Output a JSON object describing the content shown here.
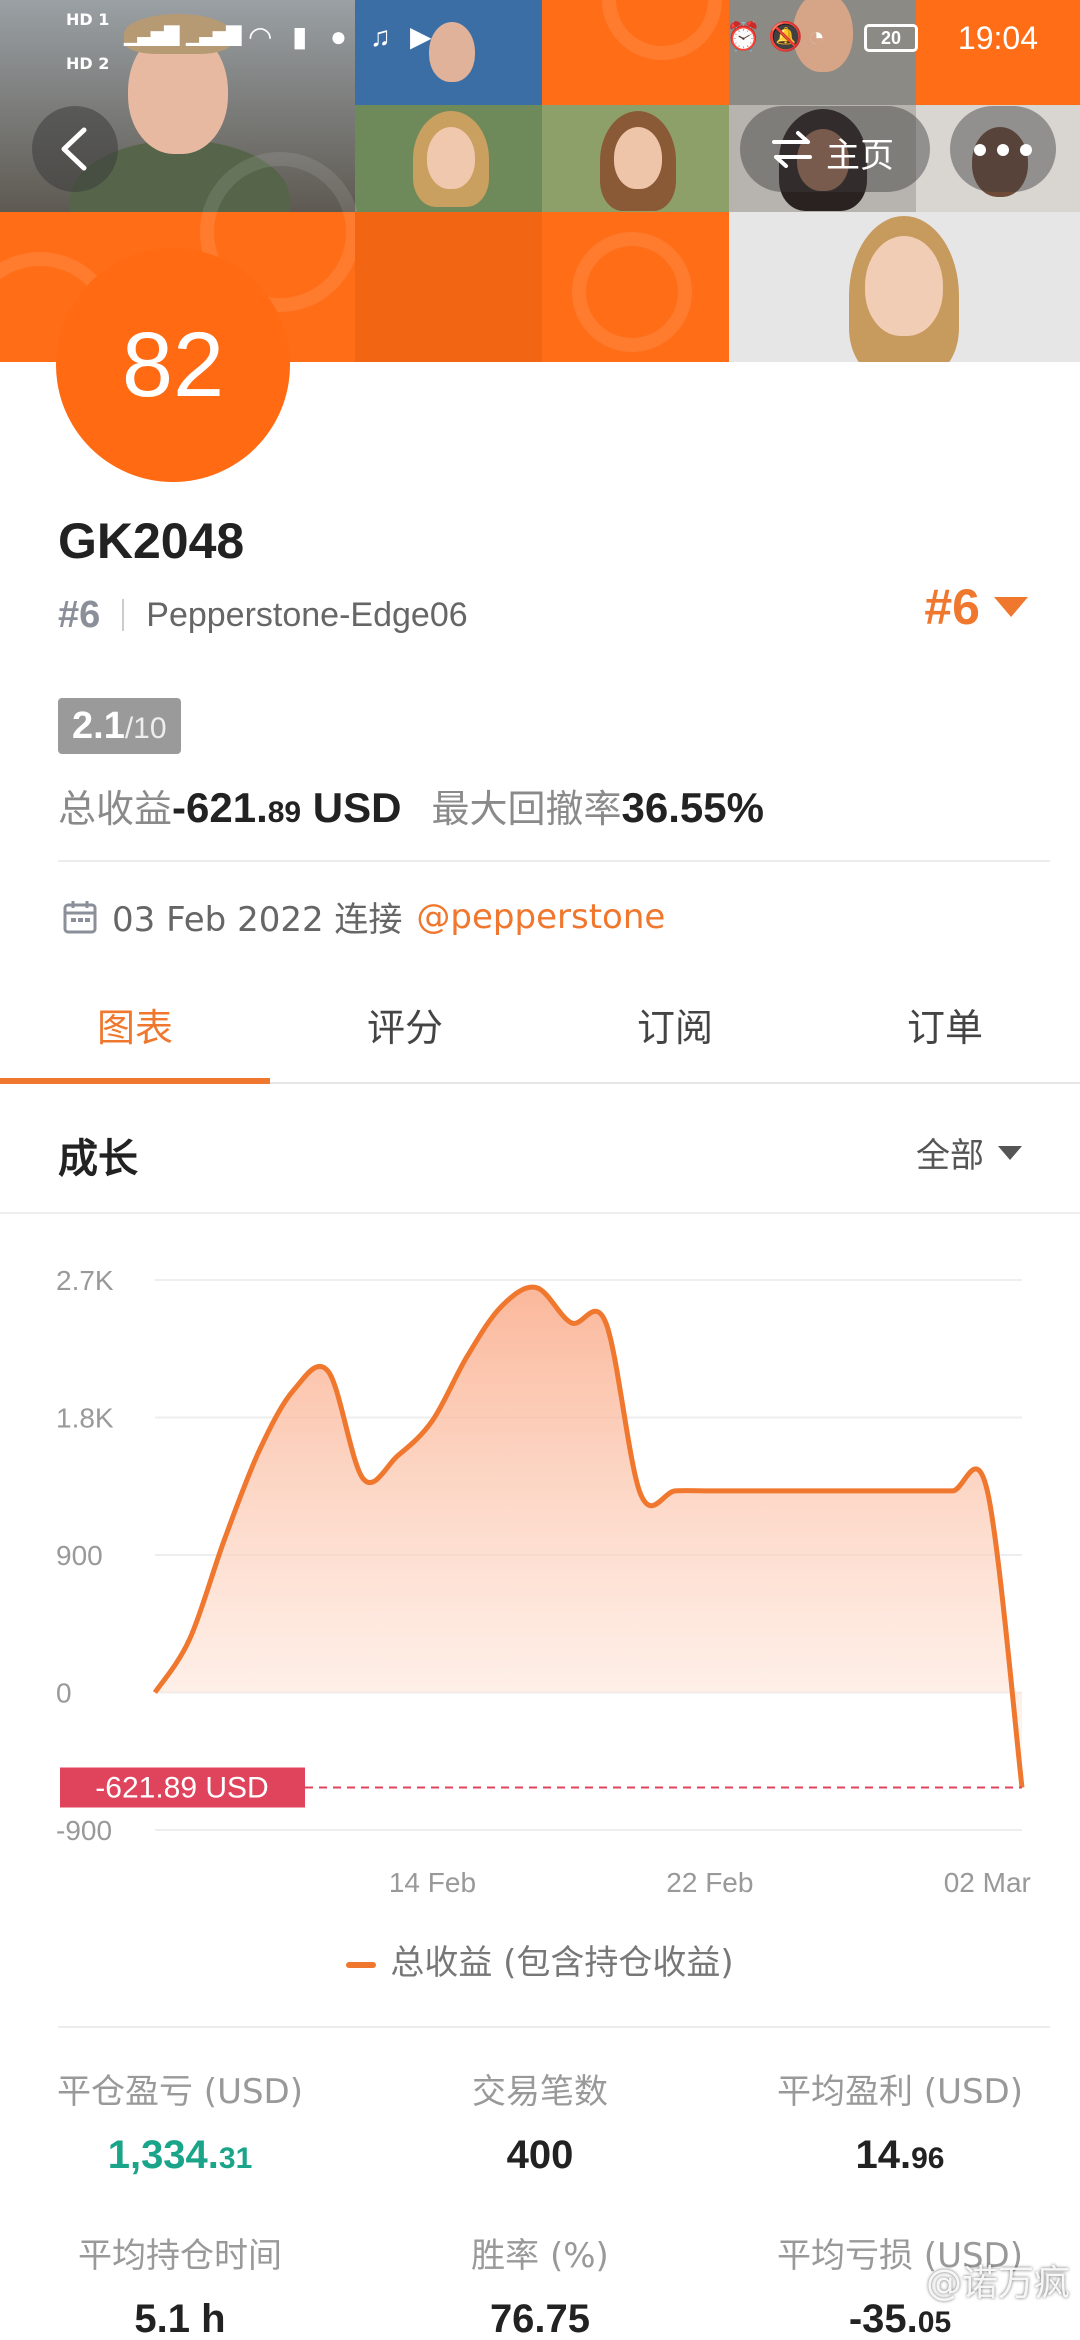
{
  "status_bar": {
    "time": "19:04",
    "battery": "20",
    "hd1": "HD 1",
    "hd2": "HD 2",
    "net1": "4G",
    "net2": "4G"
  },
  "header": {
    "home_label": "主页",
    "score": "82"
  },
  "profile": {
    "name": "GK2048",
    "rank": "#6",
    "server": "Pepperstone-Edge06",
    "rank_right": "#6",
    "rating_value": "2.1",
    "rating_scale": "/10",
    "total_profit_label": "总收益",
    "total_profit_main": "-621.",
    "total_profit_cents": "89",
    "total_profit_unit": "USD",
    "max_drawdown_label": "最大回撤率",
    "max_drawdown_value": "36.55%",
    "connect_date": "03 Feb 2022 连接",
    "broker_handle": "@pepperstone"
  },
  "tabs": [
    "图表",
    "评分",
    "订阅",
    "订单"
  ],
  "active_tab": 0,
  "section": {
    "title": "成长",
    "filter_label": "全部"
  },
  "chart_data": {
    "type": "area",
    "y_ticks": [
      "2.7K",
      "1.8K",
      "900",
      "0",
      "-900"
    ],
    "ylim": [
      -900,
      2700
    ],
    "x_ticks": [
      "14 Feb",
      "22 Feb",
      "02 Mar"
    ],
    "x": [
      "06 Feb",
      "07 Feb",
      "08 Feb",
      "09 Feb",
      "10 Feb",
      "11 Feb",
      "12 Feb",
      "13 Feb",
      "14 Feb",
      "15 Feb",
      "16 Feb",
      "17 Feb",
      "18 Feb",
      "19 Feb",
      "20 Feb",
      "21 Feb",
      "22 Feb",
      "23 Feb",
      "24 Feb",
      "25 Feb",
      "26 Feb",
      "27 Feb",
      "28 Feb",
      "01 Mar",
      "02 Mar",
      "03 Mar"
    ],
    "series": [
      {
        "name": "总收益 (包含持仓收益)",
        "values": [
          0,
          350,
          1000,
          1580,
          1980,
          2100,
          1400,
          1550,
          1780,
          2200,
          2530,
          2650,
          2420,
          2420,
          1300,
          1320,
          1320,
          1320,
          1320,
          1320,
          1320,
          1320,
          1320,
          1320,
          1320,
          -621.89
        ]
      }
    ],
    "current_value_label": "-621.89 USD",
    "legend": "总收益 (包含持仓收益)",
    "colors": {
      "line": "#f0772e",
      "fill_top": "#f9a07a",
      "fill_bottom": "#fff2ea",
      "marker": "#e0445c"
    }
  },
  "stats": [
    {
      "label": "平仓盈亏 (USD)",
      "main": "1,334.",
      "cents": "31",
      "color": "green"
    },
    {
      "label": "交易笔数",
      "main": "400",
      "cents": "",
      "color": "default"
    },
    {
      "label": "平均盈利 (USD)",
      "main": "14.",
      "cents": "96",
      "color": "default"
    },
    {
      "label": "平均持仓时间",
      "main": "5.1 h",
      "cents": "",
      "color": "default"
    },
    {
      "label": "胜率 (%)",
      "main": "76.75",
      "cents": "",
      "color": "default"
    },
    {
      "label": "平均亏损 (USD)",
      "main": "-35.",
      "cents": "05",
      "color": "default"
    }
  ],
  "watermark": "@诺万疯"
}
